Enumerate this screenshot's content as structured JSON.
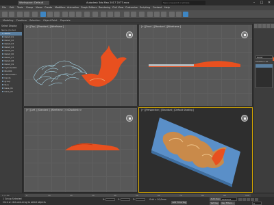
{
  "title_bar": {
    "workspace": "Workspace: Default",
    "app_title": "Autodesk 3ds Max 2017    2077.max",
    "search_placeholder": "Type a keyword or phrase",
    "minimize": "–",
    "maximize": "□",
    "close": "✕"
  },
  "menubar": {
    "items": [
      "File",
      "Edit",
      "Tools",
      "Group",
      "Views",
      "Create",
      "Modifiers",
      "Animation",
      "Graph Editors",
      "Rendering",
      "Civil View",
      "Customize",
      "Scripting",
      "Content",
      "Help"
    ]
  },
  "ribbon": {
    "tabs": [
      "Modeling",
      "Freeform",
      "Selection",
      "Object Paint",
      "Populate"
    ]
  },
  "scene_explorer": {
    "tabs": [
      "Select",
      "Display"
    ],
    "header": "Name (Sorted Ascending)",
    "items": [
      "dome",
      "Relief_01",
      "Relief_02",
      "Relief_03",
      "Relief_04",
      "Relief_05",
      "Relief_06",
      "Relief_07",
      "Relief_08",
      "Relief_09",
      "Cylinder001",
      "Box001",
      "Camera001",
      "hands",
      "group",
      "face",
      "base_01",
      "base_02"
    ],
    "selected_index": 0
  },
  "viewports": {
    "top": {
      "label": "[+] [Top ] [Standard ] [Wireframe ]"
    },
    "front": {
      "label": "[+] [Front ] [Standard ] [Wireframe ]"
    },
    "left": {
      "label": "[+] [Left ] [Standard ] [Wireframe ] <<Disabled>>"
    },
    "perspective": {
      "label": "[+] [Perspective ] [Standard ] [Default Shading ]"
    }
  },
  "command_panel": {
    "name_field": "Relief",
    "modifier_list": "Modifier List",
    "accent_color": "#e05b2e"
  },
  "timeline": {
    "frame_readout": "0 / 100",
    "ticks": [
      "0",
      "10",
      "20",
      "30",
      "40",
      "50",
      "60",
      "70",
      "80",
      "90",
      "100"
    ]
  },
  "status_bar": {
    "line1": "1 Group Selected",
    "line2": "Click or click-and-drag to select objects",
    "x_label": "X:",
    "y_label": "Y:",
    "z_label": "Z:",
    "grid_label": "Grid = 10,0mm",
    "add_time_tag": "Add Time Tag",
    "auto_key": "Auto Key",
    "set_key": "Set Key",
    "selected": "Selected",
    "key_filters": "Key Filters...",
    "frame": "0"
  },
  "colors": {
    "object_fill": "#e8501f",
    "wire_lines": "#a6d8ea",
    "active_viewport_border": "#d6a800",
    "selection_blue": "#5a7fa0"
  }
}
